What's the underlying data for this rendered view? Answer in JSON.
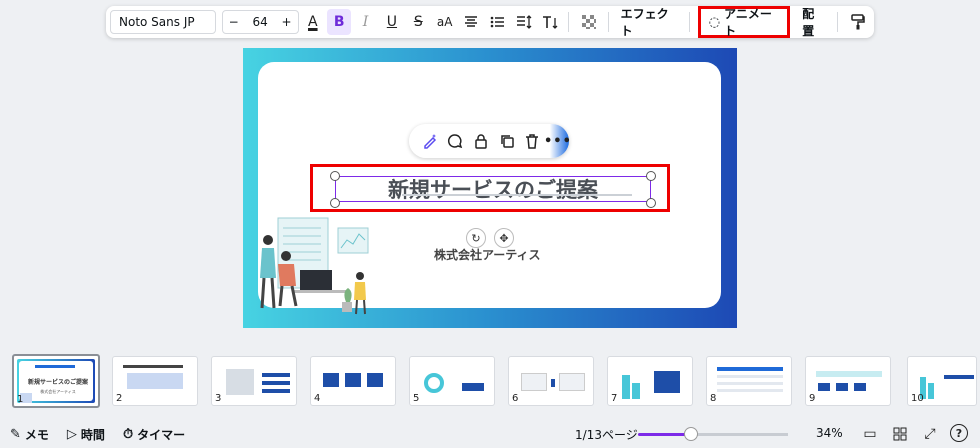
{
  "toolbar": {
    "font_family": "Noto Sans JP",
    "font_size": "64",
    "decrease": "−",
    "increase": "+",
    "effects": "エフェクト",
    "animate": "アニメート",
    "position": "配置",
    "text_color_glyph": "A",
    "bold_glyph": "B",
    "italic_glyph": "I",
    "underline_glyph": "U",
    "strike_glyph": "S",
    "case_glyph": "aA"
  },
  "slide": {
    "title": "新規サービスのご提案",
    "company": "株式会社アーティス"
  },
  "thumbnails": [
    {
      "num": "1"
    },
    {
      "num": "2"
    },
    {
      "num": "3"
    },
    {
      "num": "4"
    },
    {
      "num": "5"
    },
    {
      "num": "6"
    },
    {
      "num": "7"
    },
    {
      "num": "8"
    },
    {
      "num": "9"
    },
    {
      "num": "10"
    }
  ],
  "thumb1": {
    "title": "新規サービスのご提案",
    "company": "株式会社アーティス"
  },
  "bottombar": {
    "notes": "メモ",
    "timing": "時間",
    "timer": "タイマー",
    "pages": "1/13ページ",
    "zoom": "34%",
    "help": "?"
  },
  "colors": {
    "accent": "#7d2ae8",
    "highlight": "#e00000",
    "slide_gradient_start": "#47d3e2",
    "slide_gradient_end": "#1d49b5"
  },
  "zoom_slider": {
    "value_percent": 34
  }
}
